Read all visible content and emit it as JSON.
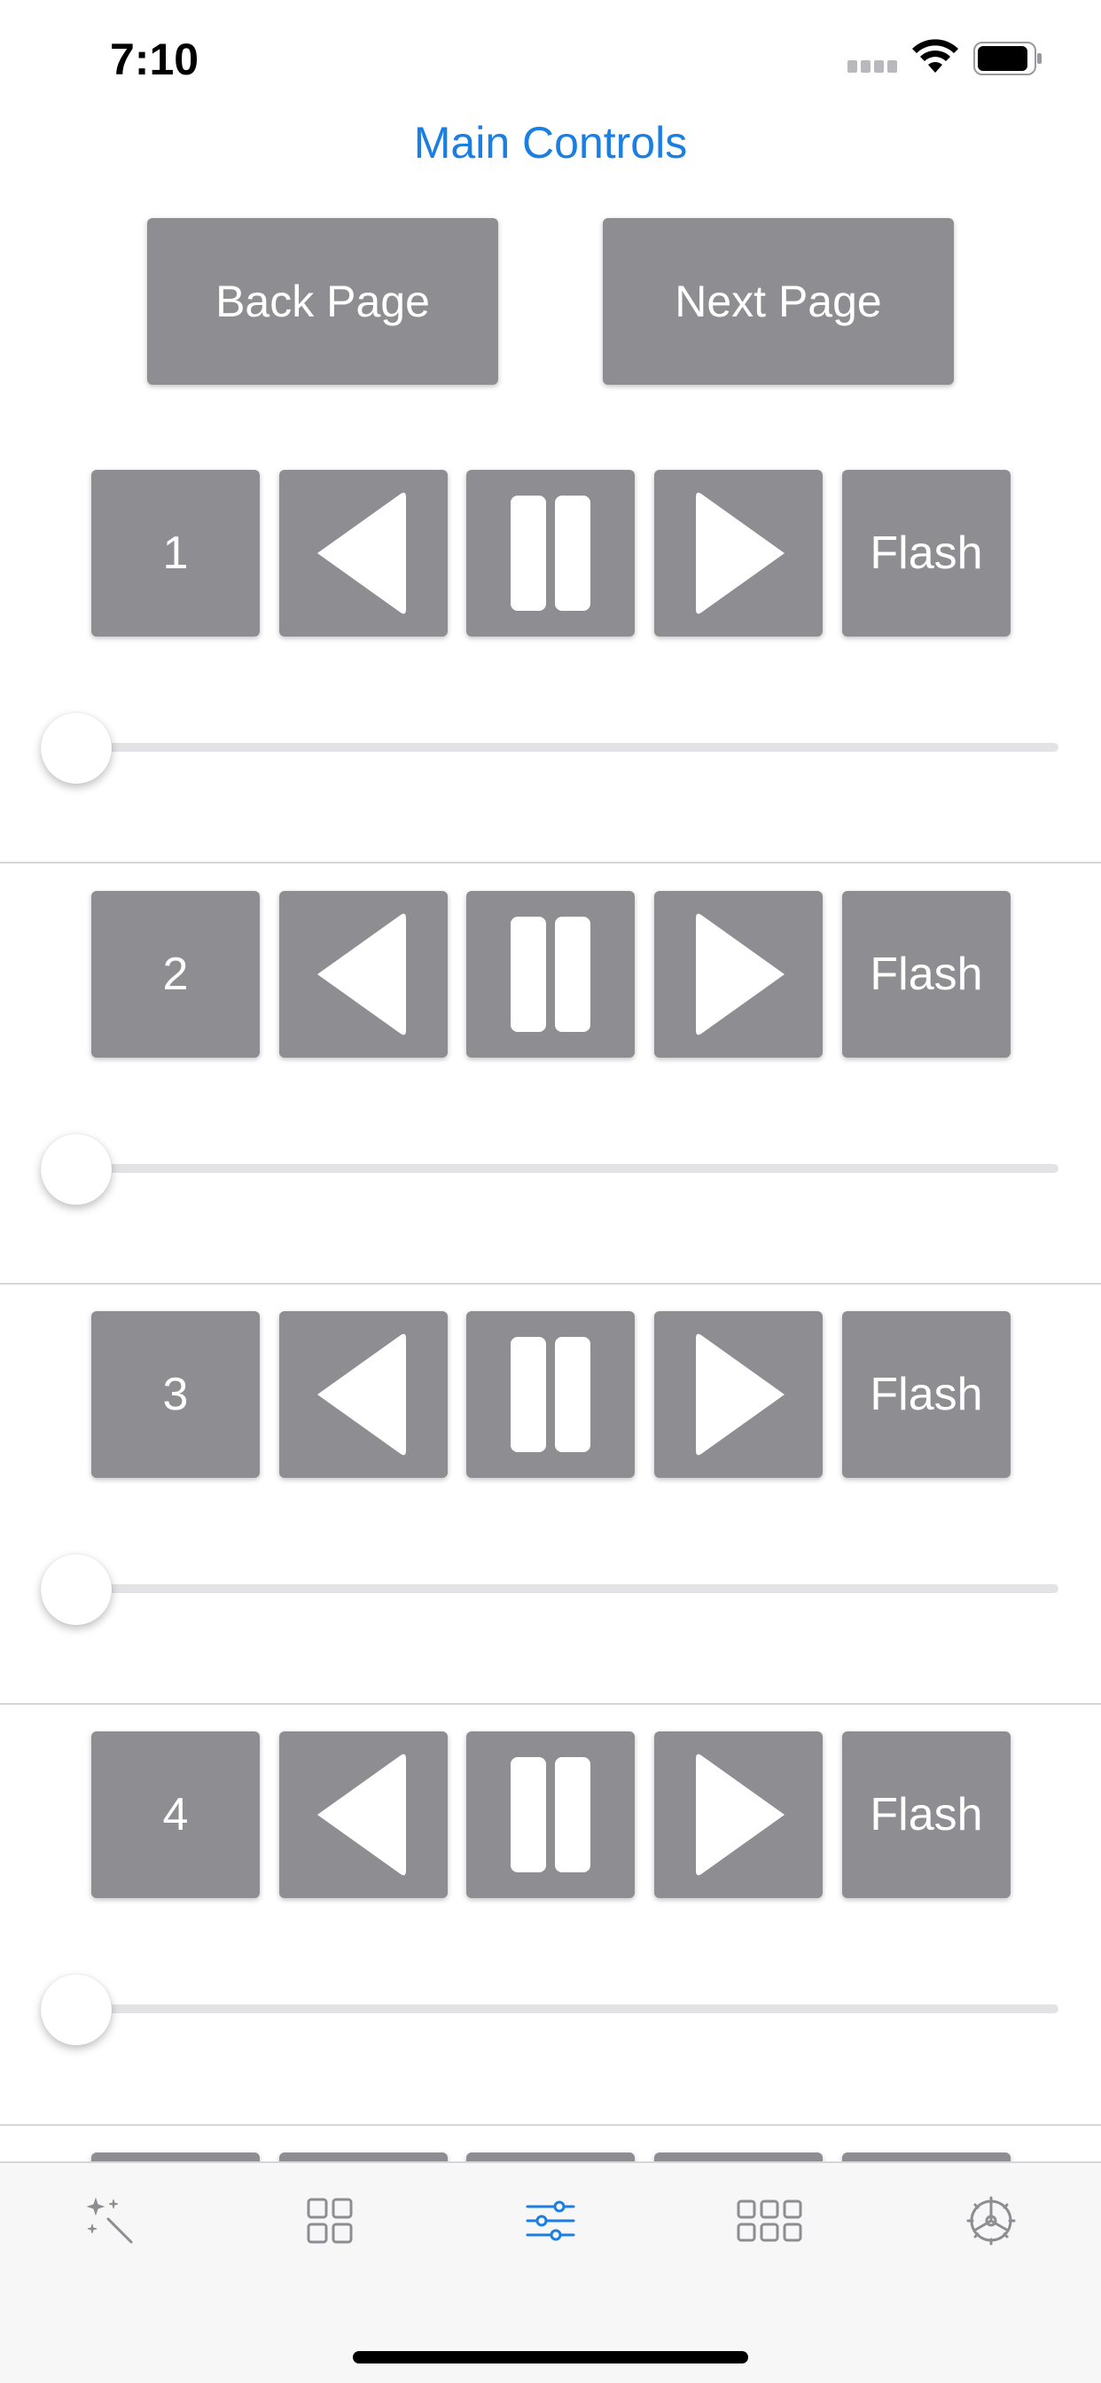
{
  "status_bar": {
    "time": "7:10"
  },
  "header": {
    "title": "Main Controls"
  },
  "page_nav": {
    "back_label": "Back Page",
    "next_label": "Next Page"
  },
  "channels": [
    {
      "number": "1",
      "flash_label": "Flash",
      "level": 0
    },
    {
      "number": "2",
      "flash_label": "Flash",
      "level": 0
    },
    {
      "number": "3",
      "flash_label": "Flash",
      "level": 0
    },
    {
      "number": "4",
      "flash_label": "Flash",
      "level": 0
    }
  ],
  "tab_bar": {
    "active_index": 2,
    "tabs": [
      {
        "icon": "magic-wand-icon"
      },
      {
        "icon": "grid-2x2-icon"
      },
      {
        "icon": "sliders-icon"
      },
      {
        "icon": "grid-3x2-icon"
      },
      {
        "icon": "settings-icon"
      }
    ]
  },
  "colors": {
    "accent": "#1a7fe0",
    "button": "#8e8e92",
    "inactive_icon": "#8e8e92"
  }
}
